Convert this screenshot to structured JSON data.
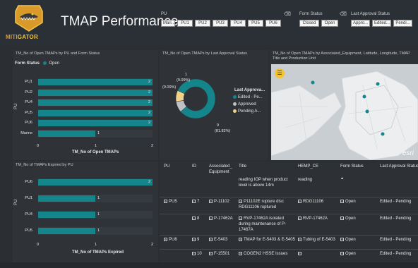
{
  "header": {
    "logo_text_1": "MITI",
    "logo_text_2": "GATOR",
    "title": "TMAP Performance",
    "pu_label": "PU",
    "pu_options": [
      "Mari...",
      "PU1",
      "PU2",
      "PU3",
      "PU4",
      "PU5",
      "PU6"
    ],
    "form_status_label": "Form Status",
    "form_status_options": [
      "Closed",
      "Open"
    ],
    "last_approval_label": "Last Approval Status",
    "last_approval_options": [
      "Appro...",
      "Edited...",
      "Pendi..."
    ]
  },
  "chart1": {
    "title": "TM_No of Open TMAPs by PU and Form Status",
    "legend_label": "Form Status",
    "legend_item": "Open",
    "ylabel": "PU",
    "xlabel": "TM_No of Open TMAPs",
    "ticks": [
      "0",
      "1",
      "2"
    ]
  },
  "chart2": {
    "title": "TM_No of Open TMAPs by Last Approval Status",
    "legend_title": "Last Approva...",
    "legend_items": [
      "Edited - Pe...",
      "Approved",
      "Pending A..."
    ],
    "label_small_1": "1",
    "label_small_1_pct": "(9.09%)",
    "label_small_2": "1",
    "label_small_2_pct": "(9.09%)",
    "label_big": "9",
    "label_big_pct": "(81.82%)"
  },
  "chart3": {
    "title": "TM_No of TMAPs Expired by PU",
    "ylabel": "PU",
    "xlabel": "TM_No of TMAPs Expired",
    "ticks": [
      "0",
      "1",
      "2"
    ]
  },
  "map": {
    "title": "TM_No of Open TMAPs by Associated_Equipment, Latitude, Longitude, TMAP Title and Production Unit",
    "watermark": "esri"
  },
  "chart_data": [
    {
      "type": "bar",
      "title": "TM_No of Open TMAPs by PU and Form Status",
      "categories": [
        "PU1",
        "PU2",
        "PU4",
        "PU5",
        "PU6",
        "Marine"
      ],
      "series": [
        {
          "name": "Open",
          "values": [
            2,
            2,
            2,
            2,
            2,
            1
          ]
        }
      ],
      "xlabel": "TM_No of Open TMAPs",
      "ylabel": "PU",
      "xlim": [
        0,
        2
      ],
      "colors": [
        "#14868b"
      ]
    },
    {
      "type": "pie",
      "title": "TM_No of Open TMAPs by Last Approval Status",
      "categories": [
        "Edited - Pe...",
        "Approved",
        "Pending A..."
      ],
      "values": [
        9,
        1,
        1
      ],
      "colors": [
        "#14868b",
        "#bfc3c6",
        "#f2d28a"
      ]
    },
    {
      "type": "bar",
      "title": "TM_No of TMAPs Expired by PU",
      "categories": [
        "PU6",
        "PU1",
        "PU4",
        "PU5"
      ],
      "values": [
        2,
        1,
        1,
        1
      ],
      "xlabel": "TM_No of TMAPs Expired",
      "ylabel": "PU",
      "xlim": [
        0,
        2
      ],
      "colors": [
        "#14868b"
      ]
    }
  ],
  "table": {
    "headers": [
      "PU",
      "ID",
      "Associated_ Equipment",
      "Title",
      "HEMP_CE",
      "Form Status",
      "Last Approval Status"
    ],
    "sort_arrow": "▲",
    "rows": [
      {
        "pu": "",
        "id": "",
        "equip": "",
        "title": "reading IOP when product level is above 14m",
        "hemp": "reading",
        "status": "",
        "approval": ""
      },
      {
        "pu": "PU5",
        "id": "7",
        "equip": "P-11102",
        "title": "P11102E rupture disc RDG11106 ruptured",
        "hemp": "RDG11106",
        "status": "Open",
        "approval": "Edited - Pending"
      },
      {
        "pu": "",
        "id": "8",
        "equip": "P-17462A",
        "title": "RVP-17462A isolated during maintenance of P-17467A",
        "hemp": "RVP-17462A",
        "status": "Open",
        "approval": "Edited - Pending"
      },
      {
        "pu": "PU6",
        "id": "9",
        "equip": "E-5403",
        "title": "TMAP for E-5403 & E-5405",
        "hemp": "Tubing of E-5403",
        "status": "Open",
        "approval": "Edited - Pending"
      },
      {
        "pu": "",
        "id": "10",
        "equip": "F-15501",
        "title": "COGEN2 HSSE Issues",
        "hemp": "",
        "status": "Open",
        "approval": "Edited - Pending"
      }
    ]
  }
}
